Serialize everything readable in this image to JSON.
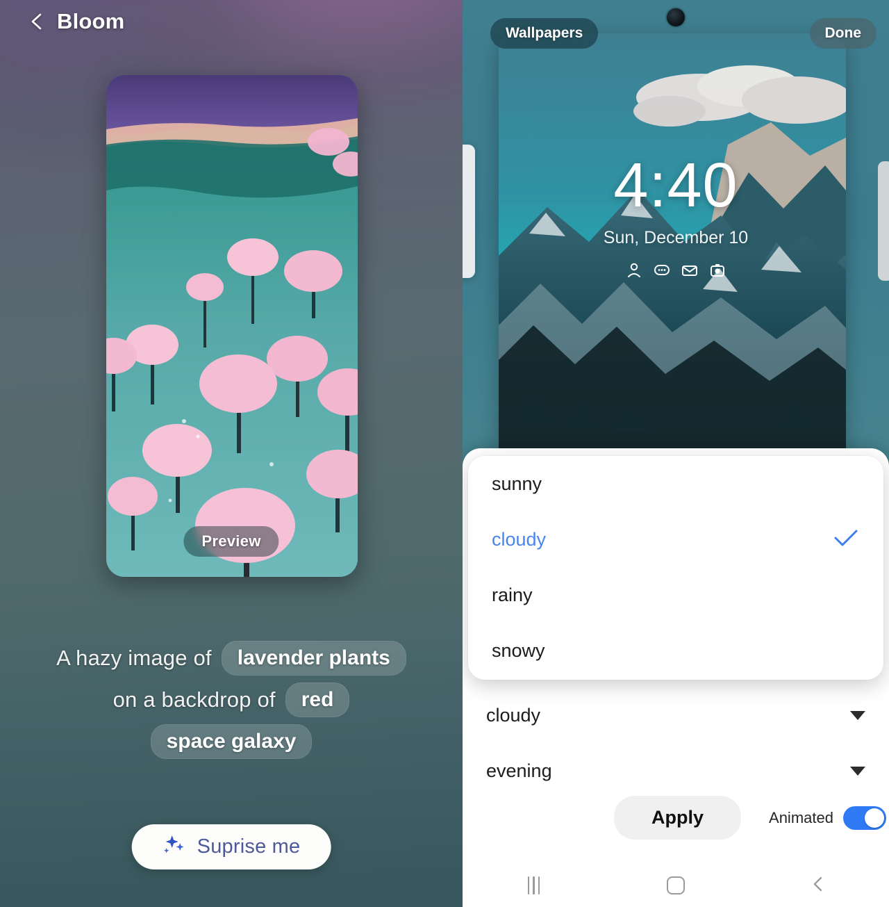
{
  "left": {
    "header": {
      "title": "Bloom",
      "back_icon": "chevron-left-icon"
    },
    "preview": {
      "label": "Preview",
      "wallpaper_alt": "cherry blossom trees in teal lake"
    },
    "prompt": {
      "line1_text": "A hazy image of",
      "line1_chip": "lavender plants",
      "line2_text": "on a backdrop of",
      "line2_chip": "red",
      "line3_chip": "space galaxy"
    },
    "surprise": {
      "label": "Suprise me",
      "icon": "sparkles-icon"
    }
  },
  "right": {
    "lock_preview": {
      "wallpapers_label": "Wallpapers",
      "done_label": "Done",
      "clock": "4:40",
      "date": "Sun, December 10",
      "shortcut_icons": [
        "person-icon",
        "chat-bubble-icon",
        "envelope-icon",
        "camera-icon"
      ]
    },
    "popup": {
      "options": [
        {
          "label": "sunny",
          "selected": false
        },
        {
          "label": "cloudy",
          "selected": true
        },
        {
          "label": "rainy",
          "selected": false
        },
        {
          "label": "snowy",
          "selected": false
        }
      ],
      "check_icon": "check-icon"
    },
    "sheet": {
      "rows": [
        {
          "value": "cloudy",
          "icon": "caret-down-icon"
        },
        {
          "value": "evening",
          "icon": "caret-down-icon"
        }
      ],
      "apply_label": "Apply",
      "animated_label": "Animated",
      "animated_on": true
    },
    "navbar": {
      "recents_icon": "recents-icon",
      "home_icon": "home-icon",
      "back_icon": "back-chevron-icon"
    }
  },
  "colors": {
    "accent_blue": "#3d7ef0",
    "option_selected": "#4a85ef",
    "toggle_on": "#2f7bf6",
    "surprise_text": "#4c5a9c"
  }
}
